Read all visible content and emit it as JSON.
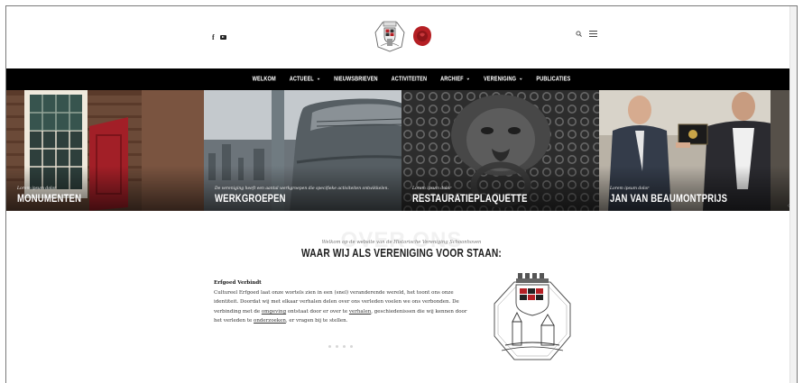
{
  "header": {
    "social": {
      "facebook_glyph": "f",
      "youtube_icon": "youtube-icon"
    }
  },
  "nav": {
    "items": [
      {
        "label": "WELKOM"
      },
      {
        "label": "ACTUEEL",
        "has_dropdown": true
      },
      {
        "label": "NIEUWSBRIEVEN"
      },
      {
        "label": "ACTIVITEITEN"
      },
      {
        "label": "ARCHIEF",
        "has_dropdown": true
      },
      {
        "label": "VERENIGING",
        "has_dropdown": true
      },
      {
        "label": "PUBLICATIES"
      }
    ]
  },
  "hero": {
    "panels": [
      {
        "caption": "Lorem ipsum dolor",
        "title": "MONUMENTEN"
      },
      {
        "caption": "De vereniging heeft een aantal werkgroepen die specifieke activiteiten ontwikkelen.",
        "title": "WERKGROEPEN"
      },
      {
        "caption": "Lorem ipsum dolor",
        "title": "RESTAURATIEPLAQUETTE"
      },
      {
        "caption": "Lorem ipsum dolor",
        "title": "JAN VAN BEAUMONTPRIJS"
      }
    ],
    "prev_arrow": "‹",
    "next_arrow": "›"
  },
  "about": {
    "ghost_title": "OVER ONS",
    "welcome": "Welkom op de website van de Historische Vereniging Schoonhoven",
    "heading": "WAAR WIJ ALS VERENIGING VOOR STAAN:",
    "subheading": "Erfgoed Verbindt",
    "p1": "Cultureel Erfgoed laat onze wortels zien in een (snel) veranderende wereld, het toont ons onze identiteit. Doordat wij met elkaar verhalen delen over ons verleden voelen we ons verbonden. De verbinding met de ",
    "link1": "omgeving",
    "p2": " ontstaat door er over te ",
    "link2": "verhalen",
    "p3": ", geschiedenissen die wij kennen door het verleden te ",
    "link3": "onderzoeken",
    "p4": ", er vragen bij te stellen."
  },
  "colors": {
    "nav_bg": "#000000",
    "accent_red": "#b51f24"
  }
}
